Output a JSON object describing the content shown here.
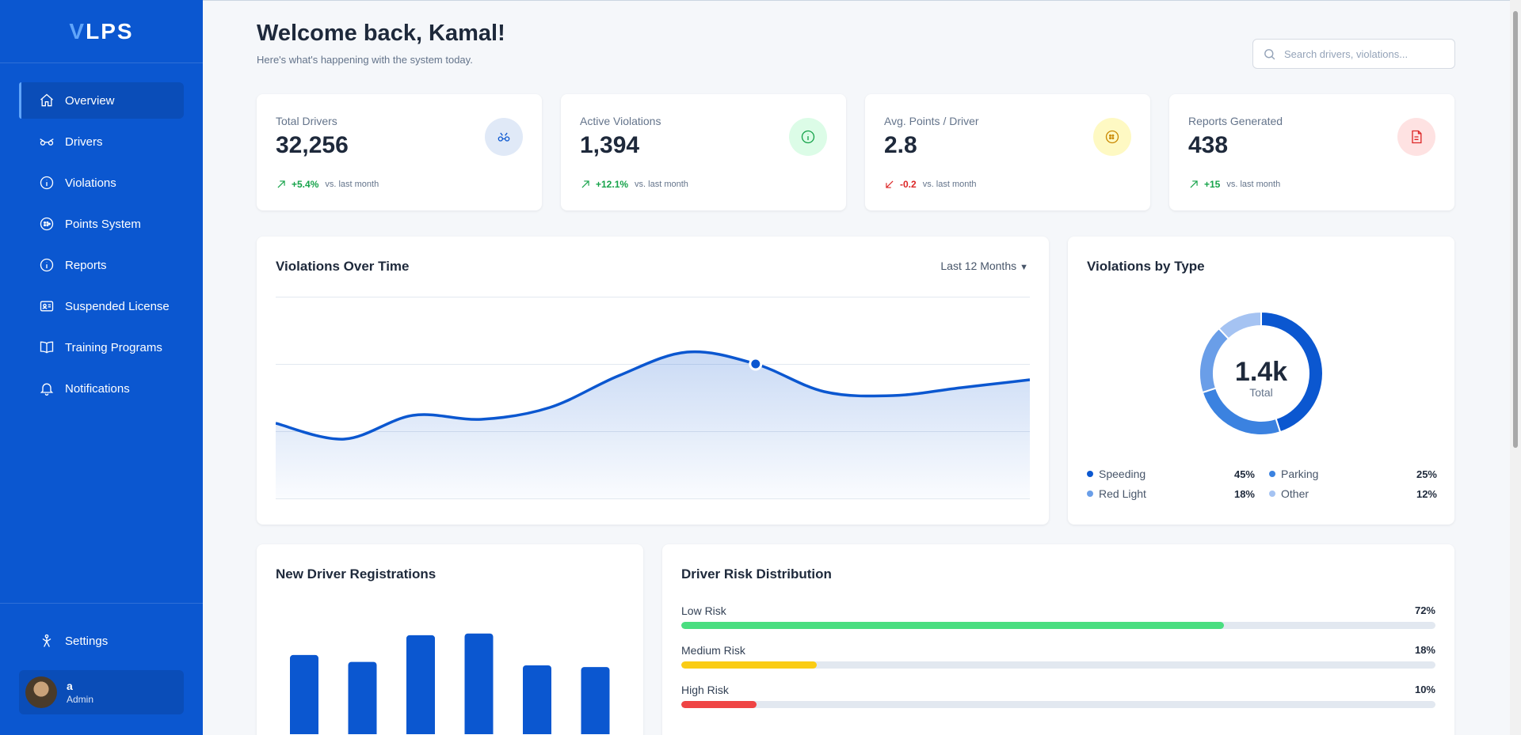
{
  "app": {
    "logo_v": "V",
    "logo_rest": "LPS"
  },
  "sidebar": {
    "items": [
      {
        "label": "Overview",
        "icon": "home-icon",
        "active": true
      },
      {
        "label": "Drivers",
        "icon": "drivers-icon"
      },
      {
        "label": "Violations",
        "icon": "info-circle-icon"
      },
      {
        "label": "Points System",
        "icon": "points-icon"
      },
      {
        "label": "Reports",
        "icon": "info-circle-icon"
      },
      {
        "label": "Suspended License",
        "icon": "id-card-icon"
      },
      {
        "label": "Training Programs",
        "icon": "book-icon"
      },
      {
        "label": "Notifications",
        "icon": "bell-icon"
      }
    ],
    "settings_label": "Settings",
    "user": {
      "name": "a",
      "role": "Admin"
    }
  },
  "header": {
    "title": "Welcome back, Kamal!",
    "subtitle": "Here's what's happening with the system today.",
    "search_placeholder": "Search drivers, violations..."
  },
  "stats": [
    {
      "label": "Total Drivers",
      "value": "32,256",
      "change": "+5.4%",
      "trend": "up",
      "compare": "vs. last month",
      "icon_bg": "#e0e9f7",
      "icon_color": "#0b57d0"
    },
    {
      "label": "Active Violations",
      "value": "1,394",
      "change": "+12.1%",
      "trend": "up",
      "compare": "vs. last month",
      "icon_bg": "#dcfce7",
      "icon_color": "#16a34a"
    },
    {
      "label": "Avg. Points / Driver",
      "value": "2.8",
      "change": "-0.2",
      "trend": "down",
      "compare": "vs. last month",
      "icon_bg": "#fef9c3",
      "icon_color": "#ca8a04"
    },
    {
      "label": "Reports Generated",
      "value": "438",
      "change": "+15",
      "trend": "up",
      "compare": "vs. last month",
      "icon_bg": "#fee2e2",
      "icon_color": "#dc2626"
    }
  ],
  "violations_over_time": {
    "title": "Violations Over Time",
    "range_label": "Last 12 Months"
  },
  "violations_by_type": {
    "title": "Violations by Type",
    "center_value": "1.4k",
    "center_label": "Total",
    "legend": [
      {
        "name": "Speeding",
        "pct": "45%",
        "color": "#0b57d0"
      },
      {
        "name": "Parking",
        "pct": "25%",
        "color": "#3b82e0"
      },
      {
        "name": "Red Light",
        "pct": "18%",
        "color": "#6a9ee8"
      },
      {
        "name": "Other",
        "pct": "12%",
        "color": "#a5c3f2"
      }
    ]
  },
  "registrations": {
    "title": "New Driver Registrations"
  },
  "risk": {
    "title": "Driver Risk Distribution",
    "levels": [
      {
        "label": "Low Risk",
        "pct": "72%",
        "value": 0.72,
        "color": "#4ade80"
      },
      {
        "label": "Medium Risk",
        "pct": "18%",
        "value": 0.18,
        "color": "#facc15"
      },
      {
        "label": "High Risk",
        "pct": "10%",
        "value": 0.1,
        "color": "#ef4444"
      }
    ]
  },
  "chart_data": [
    {
      "type": "area",
      "title": "Violations Over Time",
      "x": [
        1,
        2,
        3,
        4,
        5,
        6,
        7,
        8,
        9,
        10,
        11,
        12
      ],
      "values": [
        100,
        80,
        110,
        105,
        120,
        160,
        190,
        175,
        140,
        135,
        145,
        155
      ],
      "ylim": [
        0,
        260
      ],
      "grid": true
    },
    {
      "type": "pie",
      "title": "Violations by Type",
      "categories": [
        "Speeding",
        "Parking",
        "Red Light",
        "Other"
      ],
      "values": [
        45,
        25,
        18,
        12
      ]
    },
    {
      "type": "bar",
      "title": "New Driver Registrations",
      "values": [
        92,
        84,
        115,
        117,
        80,
        78
      ],
      "ylim": [
        0,
        200
      ]
    }
  ]
}
